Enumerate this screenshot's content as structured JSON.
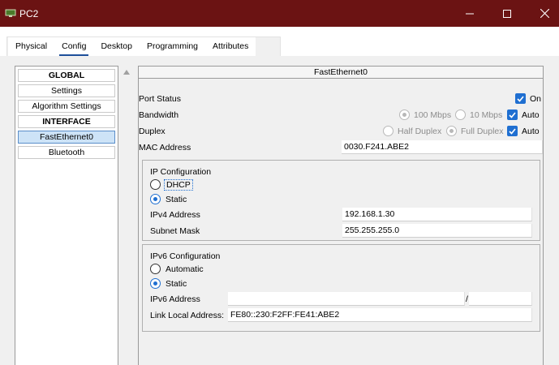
{
  "window": {
    "title": "PC2",
    "controls": {
      "minimize": "minimize",
      "maximize": "maximize",
      "close": "close"
    }
  },
  "tabs": [
    {
      "label": "Physical",
      "active": false
    },
    {
      "label": "Config",
      "active": true
    },
    {
      "label": "Desktop",
      "active": false
    },
    {
      "label": "Programming",
      "active": false
    },
    {
      "label": "Attributes",
      "active": false
    }
  ],
  "sidebar": {
    "items": [
      {
        "label": "GLOBAL",
        "header": true
      },
      {
        "label": "Settings"
      },
      {
        "label": "Algorithm Settings"
      },
      {
        "label": "INTERFACE",
        "header": true
      },
      {
        "label": "FastEthernet0",
        "selected": true
      },
      {
        "label": "Bluetooth"
      }
    ]
  },
  "interface": {
    "title": "FastEthernet0",
    "port_status": {
      "label": "Port Status",
      "on_label": "On",
      "checked": true
    },
    "bandwidth": {
      "label": "Bandwidth",
      "opt_100": "100 Mbps",
      "opt_10": "10 Mbps",
      "auto_label": "Auto",
      "auto_checked": true
    },
    "duplex": {
      "label": "Duplex",
      "opt_half": "Half Duplex",
      "opt_full": "Full Duplex",
      "auto_label": "Auto",
      "auto_checked": true
    },
    "mac": {
      "label": "MAC Address",
      "value": "0030.F241.ABE2"
    },
    "ipv4": {
      "group_label": "IP Configuration",
      "dhcp_label": "DHCP",
      "static_label": "Static",
      "selected": "Static",
      "address_label": "IPv4 Address",
      "address_value": "192.168.1.30",
      "mask_label": "Subnet Mask",
      "mask_value": "255.255.255.0"
    },
    "ipv6": {
      "group_label": "IPv6 Configuration",
      "auto_label": "Automatic",
      "static_label": "Static",
      "selected": "Static",
      "address_label": "IPv6 Address",
      "address_value": "",
      "prefix_sep": "/",
      "prefix_value": "",
      "link_local_label": "Link Local Address:",
      "link_local_value": "FE80::230:F2FF:FE41:ABE2"
    }
  },
  "colors": {
    "titlebar": "#6b1313",
    "accent": "#1f6fd1",
    "selected_item": "#cde3f7"
  }
}
